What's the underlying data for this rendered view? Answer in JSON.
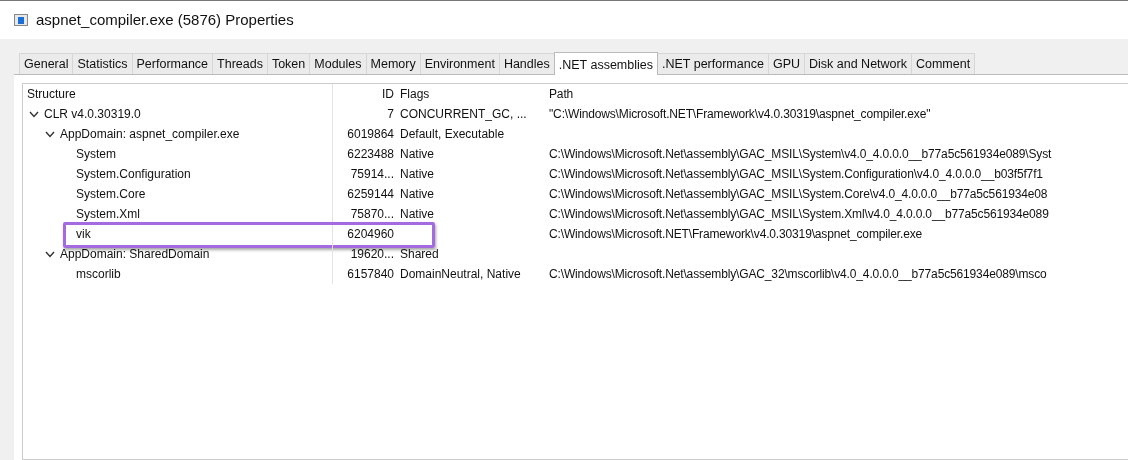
{
  "window": {
    "title": "aspnet_compiler.exe (5876) Properties"
  },
  "tabs": [
    {
      "label": "General",
      "selected": false
    },
    {
      "label": "Statistics",
      "selected": false
    },
    {
      "label": "Performance",
      "selected": false
    },
    {
      "label": "Threads",
      "selected": false
    },
    {
      "label": "Token",
      "selected": false
    },
    {
      "label": "Modules",
      "selected": false
    },
    {
      "label": "Memory",
      "selected": false
    },
    {
      "label": "Environment",
      "selected": false
    },
    {
      "label": "Handles",
      "selected": false
    },
    {
      "label": ".NET assemblies",
      "selected": true
    },
    {
      "label": ".NET performance",
      "selected": false
    },
    {
      "label": "GPU",
      "selected": false
    },
    {
      "label": "Disk and Network",
      "selected": false
    },
    {
      "label": "Comment",
      "selected": false
    }
  ],
  "tree": {
    "columns": [
      "Structure",
      "ID",
      "Flags",
      "Path"
    ],
    "rows": [
      {
        "structure": "CLR v4.0.30319.0",
        "id": "7",
        "flags": "CONCURRENT_GC, ...",
        "path": "\"C:\\Windows\\Microsoft.NET\\Framework\\v4.0.30319\\aspnet_compiler.exe\"",
        "expanded": true,
        "highlighted": false,
        "children": [
          {
            "structure": "AppDomain: aspnet_compiler.exe",
            "id": "6019864",
            "flags": "Default, Executable",
            "expanded": true,
            "highlighted": false,
            "children": [
              {
                "structure": "System",
                "id": "6223488",
                "flags": "Native",
                "path": "C:\\Windows\\Microsoft.Net\\assembly\\GAC_MSIL\\System\\v4.0_4.0.0.0__b77a5c561934e089\\Syst",
                "highlighted": false
              },
              {
                "structure": "System.Configuration",
                "id": "75914...",
                "flags": "Native",
                "path": "C:\\Windows\\Microsoft.Net\\assembly\\GAC_MSIL\\System.Configuration\\v4.0_4.0.0.0__b03f5f7f1",
                "highlighted": false
              },
              {
                "structure": "System.Core",
                "id": "6259144",
                "flags": "Native",
                "path": "C:\\Windows\\Microsoft.Net\\assembly\\GAC_MSIL\\System.Core\\v4.0_4.0.0.0__b77a5c561934e08",
                "highlighted": false
              },
              {
                "structure": "System.Xml",
                "id": "75870...",
                "flags": "Native",
                "path": "C:\\Windows\\Microsoft.Net\\assembly\\GAC_MSIL\\System.Xml\\v4.0_4.0.0.0__b77a5c561934e089",
                "highlighted": false
              },
              {
                "structure": "vik",
                "id": "6204960",
                "path": "C:\\Windows\\Microsoft.NET\\Framework\\v4.0.30319\\aspnet_compiler.exe",
                "highlighted": true
              }
            ]
          },
          {
            "structure": "AppDomain: SharedDomain",
            "id": "19620...",
            "flags": "Shared",
            "expanded": true,
            "highlighted": false,
            "children": [
              {
                "structure": "mscorlib",
                "id": "6157840",
                "flags": "DomainNeutral, Native",
                "path": "C:\\Windows\\Microsoft.Net\\assembly\\GAC_32\\mscorlib\\v4.0_4.0.0.0__b77a5c561934e089\\msco",
                "highlighted": false
              }
            ]
          }
        ]
      }
    ]
  }
}
